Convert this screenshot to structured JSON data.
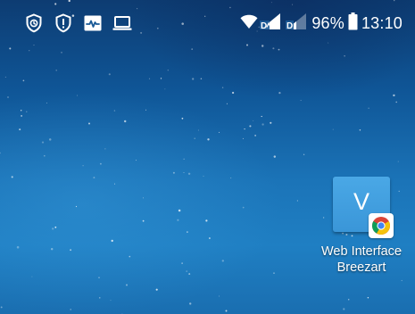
{
  "status_bar": {
    "left_icons": [
      "shield-clock-icon",
      "alert-shield-icon",
      "activity-monitor-icon",
      "laptop-icon"
    ],
    "right_icons": [
      "wifi-icon",
      "signal-sim1-icon",
      "signal-sim2-icon",
      "battery-icon"
    ],
    "battery_percent": "96%",
    "time": "13:10",
    "colors": {
      "icons": "#ffffff"
    }
  },
  "home_screen": {
    "shortcut": {
      "icon_letter": "V",
      "label_line1": "Web Interface",
      "label_line2": "Breezart",
      "badge_icon": "chrome-icon",
      "icon_color": "#3d9bdc"
    }
  },
  "wallpaper": {
    "colors": [
      "#0d3c72",
      "#0f5596",
      "#1b74b8",
      "#1f7fc3"
    ]
  }
}
